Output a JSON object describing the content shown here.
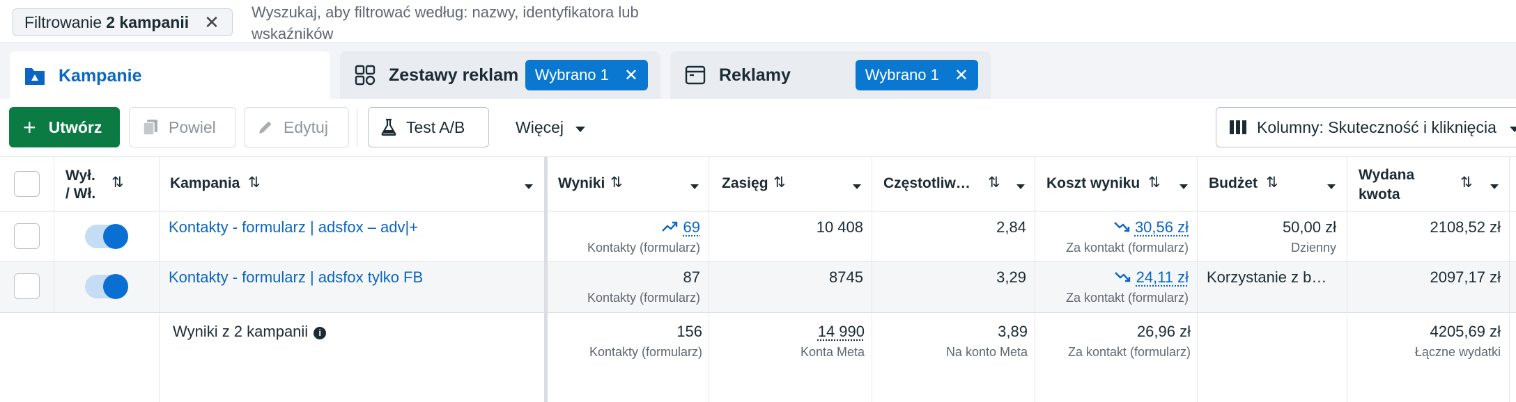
{
  "filter": {
    "chip_prefix": "Filtrowanie",
    "chip_bold": "2 kampanii",
    "search_placeholder": "Wyszukaj, aby filtrować według: nazwy, identyfikatora lub wskaźników"
  },
  "tabs": [
    {
      "label": "Kampanie",
      "icon": "campaign-folder-icon",
      "active": true
    },
    {
      "label": "Zestawy reklam",
      "icon": "ad-sets-grid-icon",
      "pill": "Wybrano 1"
    },
    {
      "label": "Reklamy",
      "icon": "ad-window-icon",
      "pill": "Wybrano 1"
    }
  ],
  "toolbar": {
    "create": "Utwórz",
    "duplicate": "Powiel",
    "edit": "Edytuj",
    "ab_test": "Test A/B",
    "more": "Więcej",
    "columns": "Kolumny: Skuteczność i kliknięcia"
  },
  "columns": {
    "onoff_line1": "Wył.",
    "onoff_line2": "/ Wł.",
    "campaign": "Kampania",
    "results": "Wyniki",
    "reach": "Zasięg",
    "frequency": "Częstotliw…",
    "cost_per_result": "Koszt wyniku",
    "budget": "Budżet",
    "spent_line1": "Wydana",
    "spent_line2": "kwota"
  },
  "rows": [
    {
      "name": "Kontakty - formularz | adsfox – adv|+",
      "results": "69",
      "results_sub": "Kontakty (formularz)",
      "reach": "10 408",
      "frequency": "2,84",
      "cost": "30,56 zł",
      "cost_sub": "Za kontakt (formularz)",
      "budget": "50,00 zł",
      "budget_sub": "Dzienny",
      "spent": "2108,52 zł",
      "enabled": true
    },
    {
      "name": "Kontakty - formularz | adsfox tylko FB",
      "results": "87",
      "results_sub": "Kontakty (formularz)",
      "reach": "8745",
      "frequency": "3,29",
      "cost": "24,11 zł",
      "cost_sub": "Za kontakt (formularz)",
      "budget": "Korzystanie z b…",
      "spent": "2097,17 zł",
      "enabled": true
    }
  ],
  "totals": {
    "label": "Wyniki z 2 kampanii",
    "results": "156",
    "results_sub": "Kontakty (formularz)",
    "reach": "14 990",
    "reach_sub": "Konta Meta",
    "frequency": "3,89",
    "frequency_sub": "Na konto Meta",
    "cost": "26,96 zł",
    "cost_sub": "Za kontakt (formularz)",
    "spent": "4205,69 zł",
    "spent_sub": "Łączne wydatki"
  },
  "colors": {
    "accent": "#0a66c2",
    "pill": "#0a78d0",
    "create": "#0b7a43"
  }
}
